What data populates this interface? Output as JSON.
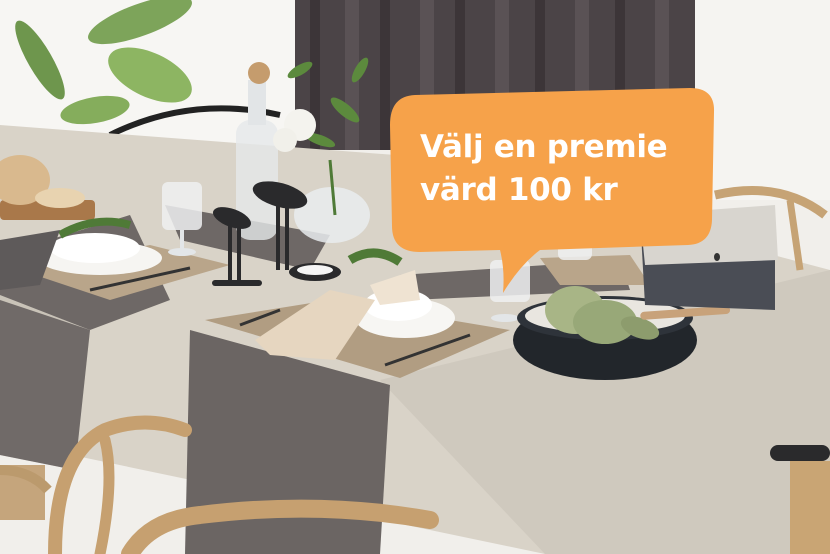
{
  "promo": {
    "line1": "Välj en premie",
    "line2": "värd 100 kr"
  },
  "colors": {
    "bubble": "#F6A24A",
    "bubble_text": "#FFFFFF",
    "curtain": "#4B4447",
    "tablecloth": "#D9D3C8",
    "runner": "#6E6866"
  }
}
